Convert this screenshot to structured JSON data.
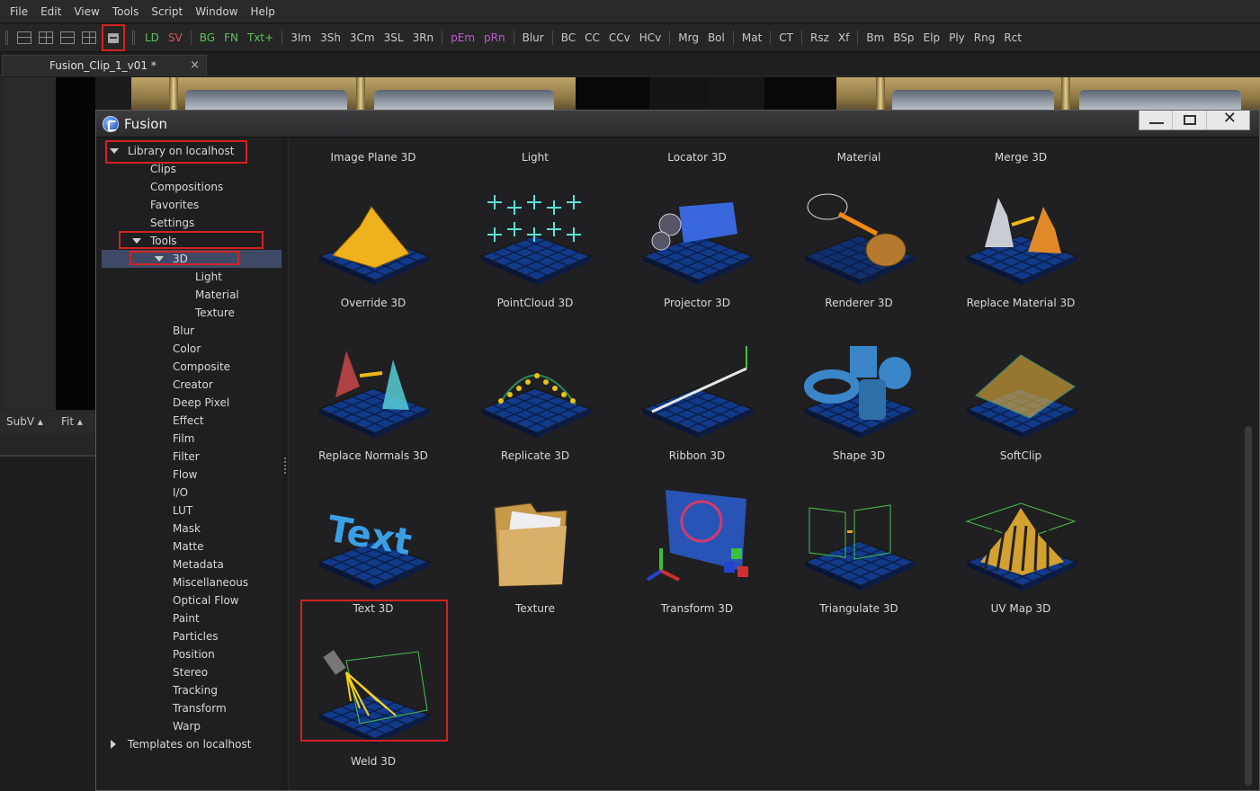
{
  "menubar": {
    "items": [
      "File",
      "Edit",
      "View",
      "Tools",
      "Script",
      "Window",
      "Help"
    ]
  },
  "toolbar": {
    "layout_icons": [
      "layout-single-icon",
      "layout-quad-icon",
      "layout-horizontal-icon",
      "layout-split-icon"
    ],
    "library_icon": "library-icon",
    "tools": [
      {
        "label": "LD",
        "color": "#5dc35d"
      },
      {
        "label": "SV",
        "color": "#e05555"
      },
      {
        "label": "BG",
        "color": "#5dc35d"
      },
      {
        "label": "FN",
        "color": "#5dc35d"
      },
      {
        "label": "Txt+",
        "color": "#5dc35d"
      },
      {
        "label": "3Im",
        "color": "#c9c9c9"
      },
      {
        "label": "3Sh",
        "color": "#c9c9c9"
      },
      {
        "label": "3Cm",
        "color": "#c9c9c9"
      },
      {
        "label": "3SL",
        "color": "#c9c9c9"
      },
      {
        "label": "3Rn",
        "color": "#c9c9c9"
      },
      {
        "label": "pEm",
        "color": "#c05bd0"
      },
      {
        "label": "pRn",
        "color": "#c05bd0"
      },
      {
        "label": "Blur",
        "color": "#c9c9c9"
      },
      {
        "label": "BC",
        "color": "#c9c9c9"
      },
      {
        "label": "CC",
        "color": "#c9c9c9"
      },
      {
        "label": "CCv",
        "color": "#c9c9c9"
      },
      {
        "label": "HCv",
        "color": "#c9c9c9"
      },
      {
        "label": "Mrg",
        "color": "#c9c9c9"
      },
      {
        "label": "Bol",
        "color": "#c9c9c9"
      },
      {
        "label": "Mat",
        "color": "#c9c9c9"
      },
      {
        "label": "CT",
        "color": "#c9c9c9"
      },
      {
        "label": "Rsz",
        "color": "#c9c9c9"
      },
      {
        "label": "Xf",
        "color": "#c9c9c9"
      },
      {
        "label": "Bm",
        "color": "#c9c9c9"
      },
      {
        "label": "BSp",
        "color": "#c9c9c9"
      },
      {
        "label": "Elp",
        "color": "#c9c9c9"
      },
      {
        "label": "Ply",
        "color": "#c9c9c9"
      },
      {
        "label": "Rng",
        "color": "#c9c9c9"
      },
      {
        "label": "Rct",
        "color": "#c9c9c9"
      }
    ]
  },
  "document_tab": {
    "title": "Fusion_Clip_1_v01 *",
    "close": "×"
  },
  "viewer": {
    "subview": "SubV ▴",
    "fit": "Fit ▴"
  },
  "window": {
    "title": "Fusion"
  },
  "sidebar": {
    "items": [
      {
        "label": "Library on localhost",
        "expander": "down"
      },
      {
        "label": "Clips",
        "expander": "none"
      },
      {
        "label": "Compositions",
        "expander": "none"
      },
      {
        "label": "Favorites",
        "expander": "none"
      },
      {
        "label": "Settings",
        "expander": "none"
      },
      {
        "label": "Tools",
        "expander": "down"
      },
      {
        "label": "3D",
        "expander": "down",
        "selected": true
      },
      {
        "label": "Light",
        "expander": "none"
      },
      {
        "label": "Material",
        "expander": "none"
      },
      {
        "label": "Texture",
        "expander": "none"
      },
      {
        "label": "Blur",
        "expander": "none"
      },
      {
        "label": "Color",
        "expander": "none"
      },
      {
        "label": "Composite",
        "expander": "none"
      },
      {
        "label": "Creator",
        "expander": "none"
      },
      {
        "label": "Deep Pixel",
        "expander": "none"
      },
      {
        "label": "Effect",
        "expander": "none"
      },
      {
        "label": "Film",
        "expander": "none"
      },
      {
        "label": "Filter",
        "expander": "none"
      },
      {
        "label": "Flow",
        "expander": "none"
      },
      {
        "label": "I/O",
        "expander": "none"
      },
      {
        "label": "LUT",
        "expander": "none"
      },
      {
        "label": "Mask",
        "expander": "none"
      },
      {
        "label": "Matte",
        "expander": "none"
      },
      {
        "label": "Metadata",
        "expander": "none"
      },
      {
        "label": "Miscellaneous",
        "expander": "none"
      },
      {
        "label": "Optical Flow",
        "expander": "none"
      },
      {
        "label": "Paint",
        "expander": "none"
      },
      {
        "label": "Particles",
        "expander": "none"
      },
      {
        "label": "Position",
        "expander": "none"
      },
      {
        "label": "Stereo",
        "expander": "none"
      },
      {
        "label": "Tracking",
        "expander": "none"
      },
      {
        "label": "Transform",
        "expander": "none"
      },
      {
        "label": "Warp",
        "expander": "none"
      },
      {
        "label": "Templates on localhost",
        "expander": "right"
      }
    ]
  },
  "grid": {
    "top_labels": [
      "Image Plane 3D",
      "Light",
      "Locator 3D",
      "Material",
      "Merge 3D"
    ],
    "tiles": [
      {
        "label": "Override 3D",
        "icon": "override-3d-icon"
      },
      {
        "label": "PointCloud 3D",
        "icon": "pointcloud-3d-icon"
      },
      {
        "label": "Projector 3D",
        "icon": "projector-3d-icon"
      },
      {
        "label": "Renderer 3D",
        "icon": "renderer-3d-icon"
      },
      {
        "label": "Replace Material 3D",
        "icon": "replace-material-3d-icon"
      },
      {
        "label": "Replace Normals 3D",
        "icon": "replace-normals-3d-icon"
      },
      {
        "label": "Replicate 3D",
        "icon": "replicate-3d-icon"
      },
      {
        "label": "Ribbon 3D",
        "icon": "ribbon-3d-icon"
      },
      {
        "label": "Shape 3D",
        "icon": "shape-3d-icon"
      },
      {
        "label": "SoftClip",
        "icon": "softclip-icon"
      },
      {
        "label": "Text 3D",
        "icon": "text-3d-icon"
      },
      {
        "label": "Texture",
        "icon": "texture-folder-icon"
      },
      {
        "label": "Transform 3D",
        "icon": "transform-3d-icon"
      },
      {
        "label": "Triangulate 3D",
        "icon": "triangulate-3d-icon"
      },
      {
        "label": "UV Map 3D",
        "icon": "uv-map-3d-icon"
      },
      {
        "label": "Weld 3D",
        "icon": "weld-3d-icon"
      }
    ]
  }
}
